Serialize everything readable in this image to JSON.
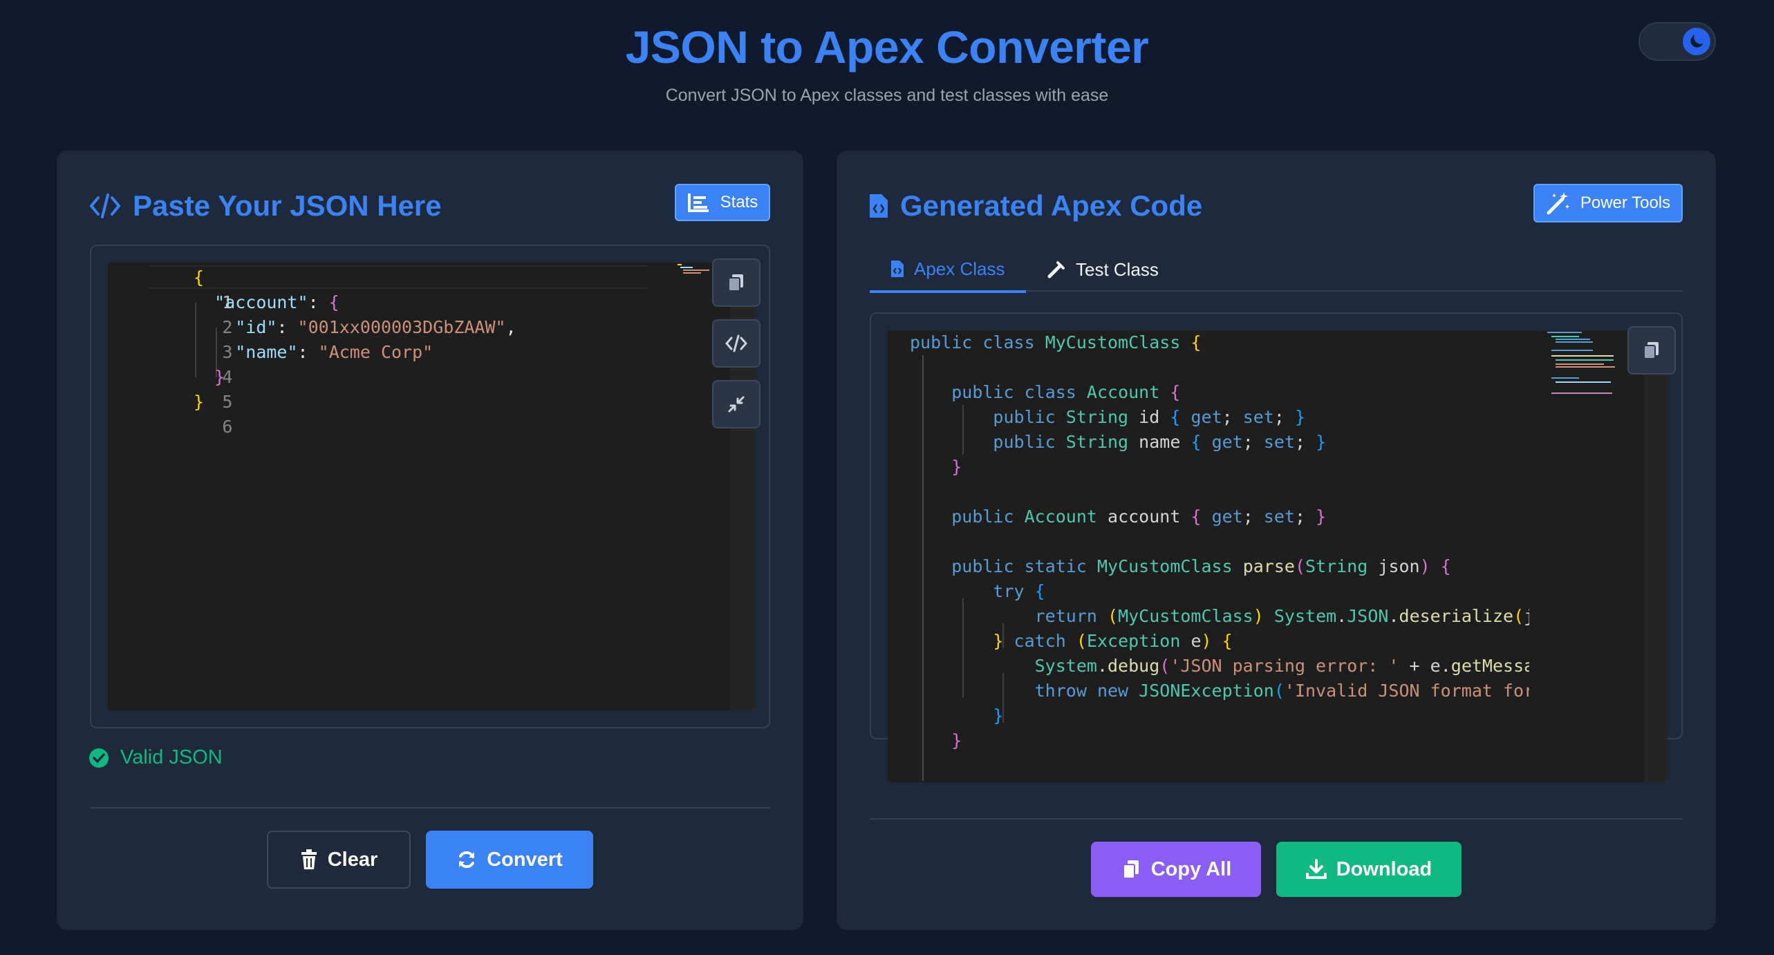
{
  "header": {
    "title": "JSON to Apex Converter",
    "subtitle": "Convert JSON to Apex classes and test classes with ease"
  },
  "theme_toggle": {
    "icon": "moon-icon",
    "mode": "dark"
  },
  "left_panel": {
    "title": "Paste Your JSON Here",
    "title_icon": "code-icon",
    "stats_label": "Stats",
    "editor": {
      "line_numbers": [
        "1",
        "2",
        "3",
        "4",
        "5",
        "6"
      ],
      "lines": [
        "{",
        "  \"account\": {",
        "    \"id\": \"001xx000003DGbZAAW\",",
        "    \"name\": \"Acme Corp\"",
        "  }",
        "}"
      ],
      "side_buttons": [
        "copy-icon",
        "format-code-icon",
        "minimize-icon"
      ]
    },
    "status": "Valid JSON",
    "clear_label": "Clear",
    "convert_label": "Convert"
  },
  "right_panel": {
    "title": "Generated Apex Code",
    "title_icon": "file-code-icon",
    "power_tools_label": "Power Tools",
    "tabs": [
      {
        "label": "Apex Class",
        "icon": "file-code-icon",
        "active": true
      },
      {
        "label": "Test Class",
        "icon": "flask-icon",
        "active": false
      }
    ],
    "code_lines": [
      "public class MyCustomClass {",
      "",
      "    public class Account {",
      "        public String id { get; set; }",
      "        public String name { get; set; }",
      "    }",
      "",
      "    public Account account { get; set; }",
      "",
      "    public static MyCustomClass parse(String json) {",
      "        try {",
      "            return (MyCustomClass) System.JSON.deserialize(jso",
      "        } catch (Exception e) {",
      "            System.debug('JSON parsing error: ' + e.getMessage",
      "            throw new JSONException('Invalid JSON format for My",
      "        }",
      "    }"
    ],
    "copy_all_label": "Copy All",
    "download_label": "Download"
  },
  "colors": {
    "background": "#101a2c",
    "panel": "#1e293b",
    "accent_blue": "#3b82f6",
    "valid_green": "#10b981",
    "copy_purple": "#8b5cf6",
    "download_green": "#10b981"
  }
}
